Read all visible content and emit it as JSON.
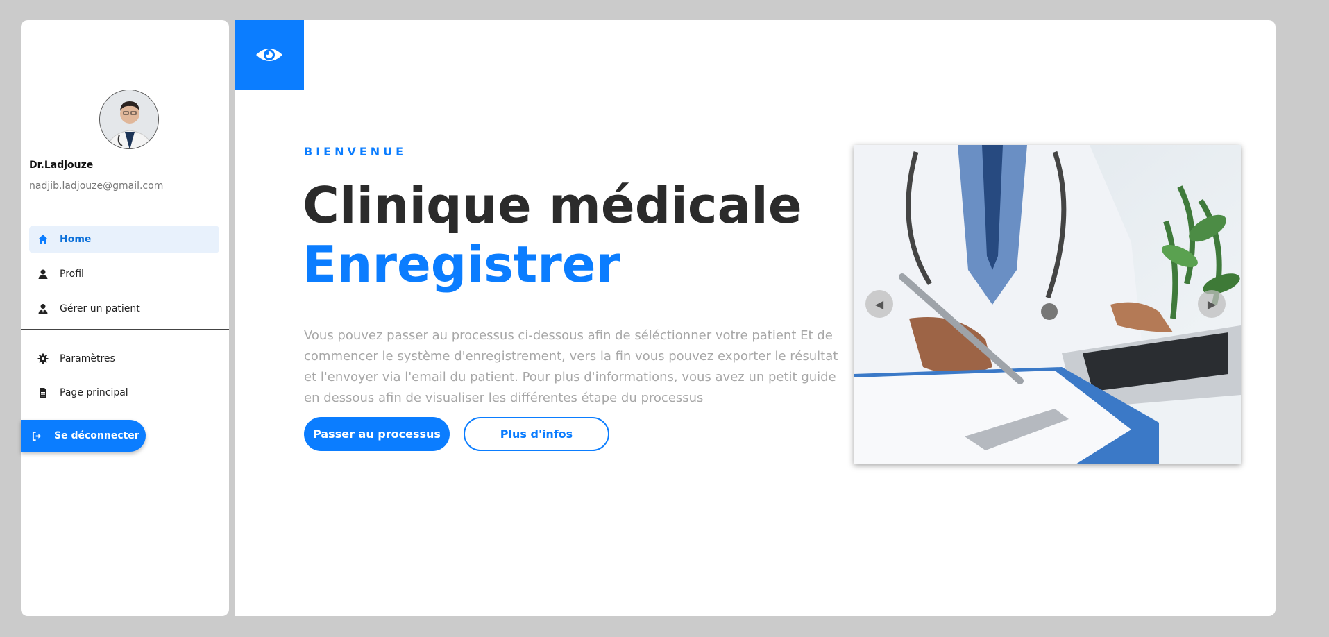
{
  "sidebar": {
    "user": {
      "name": "Dr.Ladjouze",
      "email": "nadjib.ladjouze@gmail.com"
    },
    "items": [
      {
        "label": "Home",
        "icon": "home-icon",
        "active": true
      },
      {
        "label": "Profil",
        "icon": "user-icon",
        "active": false
      },
      {
        "label": "Gérer un patient",
        "icon": "user-tie-icon",
        "active": false
      },
      {
        "label": "Paramètres",
        "icon": "gear-icon",
        "active": false
      },
      {
        "label": "Page principal",
        "icon": "file-icon",
        "active": false
      }
    ],
    "logout_label": "Se déconnecter"
  },
  "hero": {
    "kicker": "BIENVENUE",
    "title_line1": "Clinique médicale",
    "title_line2": "Enregistrer",
    "description": "Vous pouvez passer au processus ci-dessous afin de séléctionner votre patient Et de commencer le système d'enregistrement, vers la fin vous pouvez exporter le résultat et l'envoyer via l'email du patient. Pour plus d'informations, vous avez un petit guide en dessous afin de visualiser les différentes étape du processus",
    "primary_button": "Passer au processus",
    "secondary_button": "Plus d'infos"
  },
  "carousel": {
    "prev_glyph": "◀",
    "next_glyph": "▶"
  },
  "colors": {
    "accent": "#0b7dff",
    "background": "#cbcbcb",
    "title": "#2b2b2b",
    "muted_text": "#a7a7a7"
  }
}
